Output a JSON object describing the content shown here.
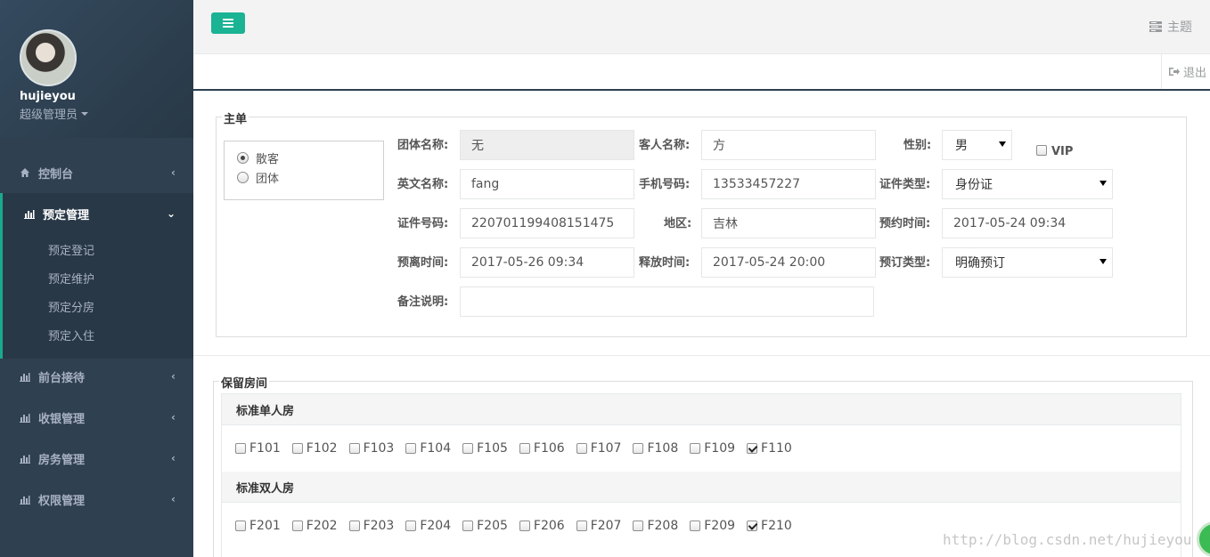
{
  "user": {
    "name": "hujieyou",
    "role": "超级管理员"
  },
  "nav": {
    "dashboard": "控制台",
    "booking": "预定管理",
    "booking_sub": [
      "预定登记",
      "预定维护",
      "预定分房",
      "预定入住"
    ],
    "reception": "前台接待",
    "cashier": "收银管理",
    "housekeeping": "房务管理",
    "permission": "权限管理"
  },
  "header": {
    "theme": "主题",
    "logout": "退出"
  },
  "form": {
    "legend": "主单",
    "type_options": [
      "散客",
      "团体"
    ],
    "type_selected": "散客",
    "group_name_label": "团体名称:",
    "group_name": "无",
    "guest_name_label": "客人名称:",
    "guest_name": "方",
    "gender_label": "性别:",
    "gender": "男",
    "vip_label": "VIP",
    "vip_checked": false,
    "english_name_label": "英文名称:",
    "english_name": "fang",
    "phone_label": "手机号码:",
    "phone": "13533457227",
    "id_type_label": "证件类型:",
    "id_type": "身份证",
    "id_number_label": "证件号码:",
    "id_number": "220701199408151475",
    "region_label": "地区:",
    "region": "吉林",
    "booking_time_label": "预约时间:",
    "booking_time": "2017-05-24 09:34",
    "departure_time_label": "预离时间:",
    "departure_time": "2017-05-26 09:34",
    "release_time_label": "释放时间:",
    "release_time": "2017-05-24 20:00",
    "booking_type_label": "预订类型:",
    "booking_type": "明确预订",
    "remarks_label": "备注说明:",
    "remarks": ""
  },
  "rooms": {
    "legend": "保留房间",
    "groups": [
      {
        "name": "标准单人房",
        "rooms": [
          "F101",
          "F102",
          "F103",
          "F104",
          "F105",
          "F106",
          "F107",
          "F108",
          "F109",
          "F110"
        ],
        "checked": [
          "F110"
        ]
      },
      {
        "name": "标准双人房",
        "rooms": [
          "F201",
          "F202",
          "F203",
          "F204",
          "F205",
          "F206",
          "F207",
          "F208",
          "F209",
          "F210"
        ],
        "checked": [
          "F210"
        ]
      }
    ]
  },
  "watermark": "http://blog.csdn.net/hujieyou",
  "colors": {
    "sidebar": "#2f4050",
    "accent": "#1ab394"
  }
}
